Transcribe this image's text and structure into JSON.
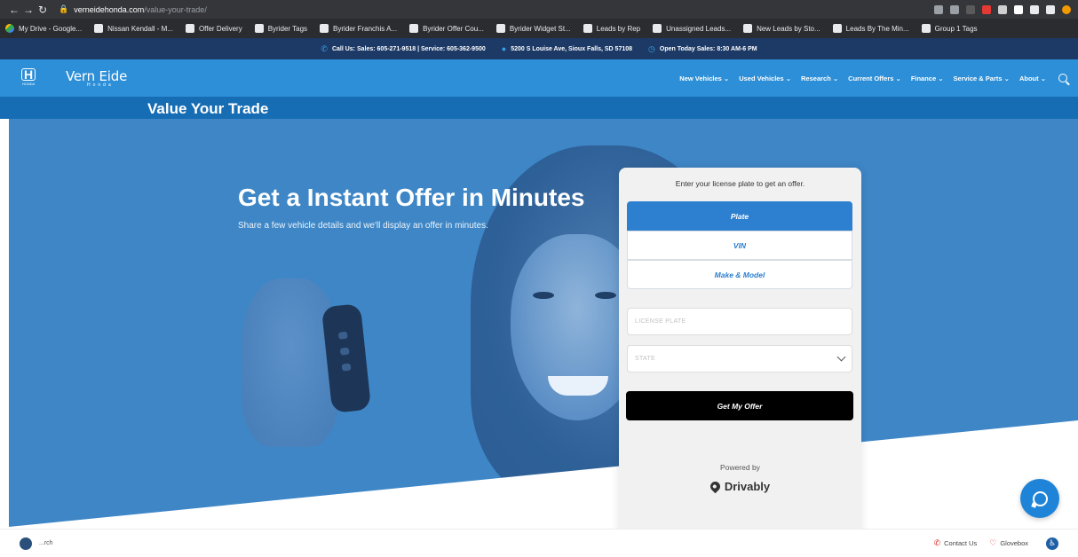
{
  "browser": {
    "url_host": "verneidehonda.com",
    "url_path": "/value-your-trade/",
    "bookmarks": [
      "My Drive - Google...",
      "Nissan Kendall - M...",
      "Offer Delivery",
      "Byrider Tags",
      "Byrider Franchis A...",
      "Byrider Offer Cou...",
      "Byrider Widget St...",
      "Leads by Rep",
      "Unassigned Leads...",
      "New Leads by Sto...",
      "Leads By The Min...",
      "Group 1 Tags"
    ]
  },
  "topbar": {
    "call": "Call Us:  Sales: 605-271-9518 | Service: 605-362-9500",
    "address": "5200 S Louise Ave, Sioux Falls, SD 57108",
    "hours": "Open Today Sales: 8:30 AM-6 PM"
  },
  "brand": {
    "logo_text": "HONDA",
    "name": "Vern Eide",
    "sub": "Honda"
  },
  "menu": [
    "New Vehicles",
    "Used Vehicles",
    "Research",
    "Current Offers",
    "Finance",
    "Service & Parts",
    "About"
  ],
  "page_title": "Value Your Trade",
  "hero": {
    "heading": "Get a Instant Offer in Minutes",
    "subtext": "Share a few vehicle details and we'll display an offer in minutes."
  },
  "card": {
    "prompt": "Enter your license plate to get an offer.",
    "tabs": [
      "Plate",
      "VIN",
      "Make & Model"
    ],
    "active_tab": "Plate",
    "plate_placeholder": "LICENSE PLATE",
    "state_placeholder": "STATE",
    "cta": "Get My Offer",
    "powered_by": "Powered by",
    "provider": "Drivably"
  },
  "bottombar": {
    "search": "...rch",
    "contact": "Contact Us",
    "glovebox": "Glovebox"
  },
  "colors": {
    "nav_blue": "#2d8fd7",
    "title_blue": "#176db3",
    "topbar_navy": "#1d3a66",
    "hero_blue": "#3e86c6",
    "tab_blue": "#2d7fcf",
    "cta_black": "#000000"
  },
  "icons": {
    "lock": "lock-icon",
    "search": "search-icon",
    "chat": "chat-icon",
    "phone": "phone-icon",
    "heart": "heart-icon",
    "accessibility": "accessibility-icon",
    "chevron": "chevron-down-icon"
  }
}
